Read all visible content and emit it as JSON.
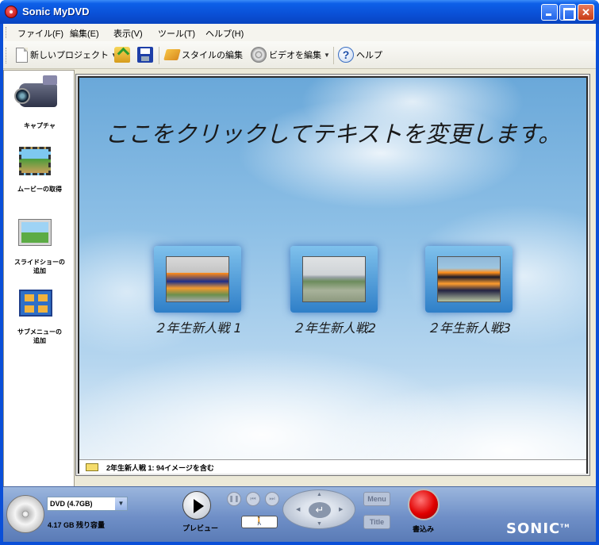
{
  "window": {
    "title": "Sonic MyDVD"
  },
  "menubar": {
    "items": [
      "ファイル(F)",
      "編集(E)",
      "表示(V)",
      "ツール(T)",
      "ヘルプ(H)"
    ]
  },
  "toolbar": {
    "new_project": "新しいプロジェクト",
    "edit_style": "スタイルの編集",
    "edit_video": "ビデオを編集",
    "help": "ヘルプ",
    "help_glyph": "?"
  },
  "sidebar": {
    "items": [
      {
        "label": "キャプチャ",
        "icon": "camcorder-icon"
      },
      {
        "label": "ムービーの取得",
        "icon": "film-icon"
      },
      {
        "label": "スライドショーの追加",
        "icon": "slideshow-icon"
      },
      {
        "label": "サブメニューの追加",
        "icon": "submenu-icon"
      }
    ]
  },
  "preview": {
    "title": "ここをクリックしてテキストを変更します。",
    "buttons": [
      {
        "label": "２年生新人戦 1"
      },
      {
        "label": "２年生新人戦2"
      },
      {
        "label": "２年生新人戦3"
      }
    ],
    "status": "2年生新人戦 1: 94イメージを含む"
  },
  "bottom": {
    "disc_type": "DVD (4.7GB)",
    "remaining": "4.17 GB 残り容量",
    "preview_label": "プレビュー",
    "menu_label": "Menu",
    "title_label": "Title",
    "burn_label": "書込み",
    "brand": "SONIC"
  },
  "colors": {
    "titlebar": "#0a50d6",
    "burn": "#e00000",
    "sky": "#8ec0e6"
  }
}
